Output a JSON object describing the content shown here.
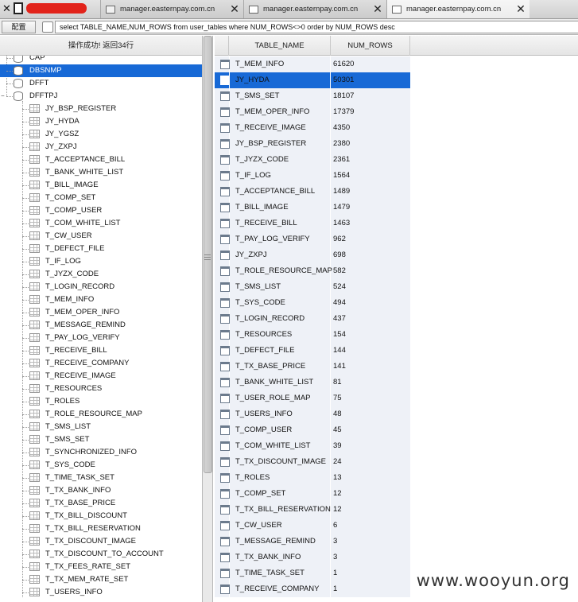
{
  "tabs": [
    {
      "label": "manager.easternpay.com.cn",
      "active": false
    },
    {
      "label": "manager.easternpay.com.cn",
      "active": false
    },
    {
      "label": "manager.easternpay.com.cn",
      "active": true
    }
  ],
  "toolbar": {
    "config_label": "配置",
    "sql": "select TABLE_NAME,NUM_ROWS from user_tables where NUM_ROWS<>0 order by NUM_ROWS desc"
  },
  "status": "操作成功! 返回34行",
  "tree": {
    "schemas": [
      {
        "label": "CAP",
        "selected": false
      },
      {
        "label": "DBSNMP",
        "selected": true
      },
      {
        "label": "DFFT",
        "selected": false
      },
      {
        "label": "DFFTPJ",
        "selected": false
      }
    ],
    "tables": [
      "JY_BSP_REGISTER",
      "JY_HYDA",
      "JY_YGSZ",
      "JY_ZXPJ",
      "T_ACCEPTANCE_BILL",
      "T_BANK_WHITE_LIST",
      "T_BILL_IMAGE",
      "T_COMP_SET",
      "T_COMP_USER",
      "T_COM_WHITE_LIST",
      "T_CW_USER",
      "T_DEFECT_FILE",
      "T_IF_LOG",
      "T_JYZX_CODE",
      "T_LOGIN_RECORD",
      "T_MEM_INFO",
      "T_MEM_OPER_INFO",
      "T_MESSAGE_REMIND",
      "T_PAY_LOG_VERIFY",
      "T_RECEIVE_BILL",
      "T_RECEIVE_COMPANY",
      "T_RECEIVE_IMAGE",
      "T_RESOURCES",
      "T_ROLES",
      "T_ROLE_RESOURCE_MAP",
      "T_SMS_LIST",
      "T_SMS_SET",
      "T_SYNCHRONIZED_INFO",
      "T_SYS_CODE",
      "T_TIME_TASK_SET",
      "T_TX_BANK_INFO",
      "T_TX_BASE_PRICE",
      "T_TX_BILL_DISCOUNT",
      "T_TX_BILL_RESERVATION",
      "T_TX_DISCOUNT_IMAGE",
      "T_TX_DISCOUNT_TO_ACCOUNT",
      "T_TX_FEES_RATE_SET",
      "T_TX_MEM_RATE_SET",
      "T_USERS_INFO"
    ]
  },
  "grid": {
    "columns": [
      "TABLE_NAME",
      "NUM_ROWS"
    ],
    "selected_row": 1,
    "rows": [
      [
        "T_MEM_INFO",
        "61620"
      ],
      [
        "JY_HYDA",
        "50301"
      ],
      [
        "T_SMS_SET",
        "18107"
      ],
      [
        "T_MEM_OPER_INFO",
        "17379"
      ],
      [
        "T_RECEIVE_IMAGE",
        "4350"
      ],
      [
        "JY_BSP_REGISTER",
        "2380"
      ],
      [
        "T_JYZX_CODE",
        "2361"
      ],
      [
        "T_IF_LOG",
        "1564"
      ],
      [
        "T_ACCEPTANCE_BILL",
        "1489"
      ],
      [
        "T_BILL_IMAGE",
        "1479"
      ],
      [
        "T_RECEIVE_BILL",
        "1463"
      ],
      [
        "T_PAY_LOG_VERIFY",
        "962"
      ],
      [
        "JY_ZXPJ",
        "698"
      ],
      [
        "T_ROLE_RESOURCE_MAP",
        "582"
      ],
      [
        "T_SMS_LIST",
        "524"
      ],
      [
        "T_SYS_CODE",
        "494"
      ],
      [
        "T_LOGIN_RECORD",
        "437"
      ],
      [
        "T_RESOURCES",
        "154"
      ],
      [
        "T_DEFECT_FILE",
        "144"
      ],
      [
        "T_TX_BASE_PRICE",
        "141"
      ],
      [
        "T_BANK_WHITE_LIST",
        "81"
      ],
      [
        "T_USER_ROLE_MAP",
        "75"
      ],
      [
        "T_USERS_INFO",
        "48"
      ],
      [
        "T_COMP_USER",
        "45"
      ],
      [
        "T_COM_WHITE_LIST",
        "39"
      ],
      [
        "T_TX_DISCOUNT_IMAGE",
        "24"
      ],
      [
        "T_ROLES",
        "13"
      ],
      [
        "T_COMP_SET",
        "12"
      ],
      [
        "T_TX_BILL_RESERVATION",
        "12"
      ],
      [
        "T_CW_USER",
        "6"
      ],
      [
        "T_MESSAGE_REMIND",
        "3"
      ],
      [
        "T_TX_BANK_INFO",
        "3"
      ],
      [
        "T_TIME_TASK_SET",
        "1"
      ],
      [
        "T_RECEIVE_COMPANY",
        "1"
      ]
    ]
  },
  "watermark": "www.wooyun.org",
  "colors": {
    "selection": "#1769d6",
    "cell": "#eef1f7",
    "redaction": "#e2231a"
  }
}
